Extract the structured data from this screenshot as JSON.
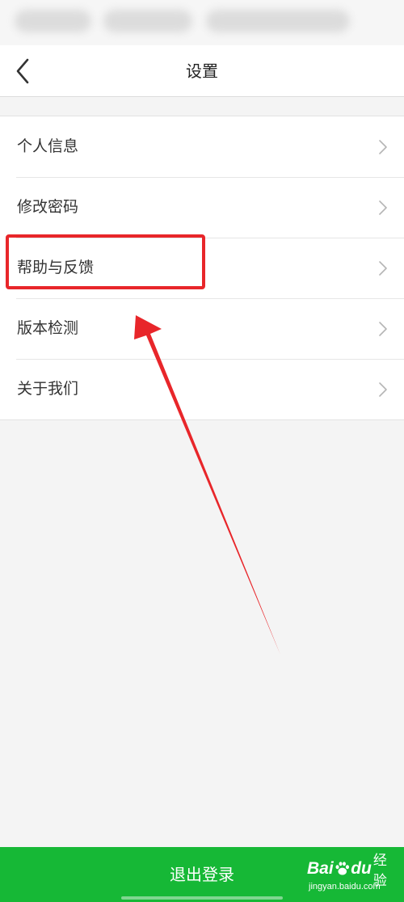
{
  "header": {
    "title": "设置"
  },
  "menu": {
    "items": [
      {
        "label": "个人信息"
      },
      {
        "label": "修改密码"
      },
      {
        "label": "帮助与反馈",
        "highlighted": true
      },
      {
        "label": "版本检测"
      },
      {
        "label": "关于我们"
      }
    ]
  },
  "footer": {
    "logout_label": "退出登录"
  },
  "watermark": {
    "brand_left": "Bai",
    "brand_right": "du",
    "brand_cn": "经验",
    "url": "jingyan.baidu.com"
  },
  "colors": {
    "accent_green": "#16b836",
    "annotation_red": "#e8262a"
  },
  "icons": {
    "back": "chevron-left-icon",
    "row": "chevron-right-icon"
  }
}
